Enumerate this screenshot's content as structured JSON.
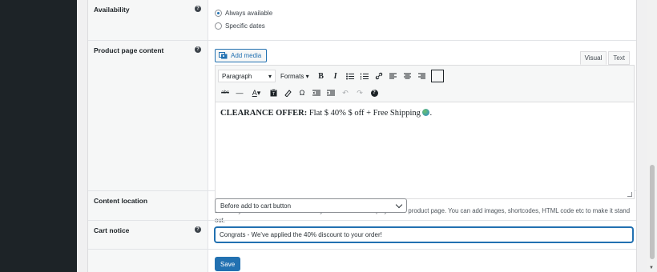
{
  "rows": {
    "availability": {
      "label": "Availability",
      "options": [
        "Always available",
        "Specific dates"
      ]
    },
    "product_content": {
      "label": "Product page content",
      "add_media": "Add media",
      "tabs": [
        "Visual",
        "Text"
      ],
      "toolbar": {
        "paragraph": "Paragraph",
        "formats": "Formats"
      },
      "content_bold": "CLEARANCE OFFER:",
      "content_rest": " Flat  $ 40% $  off + Free Shipping ",
      "content_end": ".",
      "description": "Enter any text about the discount that you would like to display on the product page. You can add images, shortcodes, HTML code etc to make it stand out."
    },
    "content_location": {
      "label": "Content location",
      "selected": "Before add to cart button"
    },
    "cart_notice": {
      "label": "Cart notice",
      "value": "Congrats - We've applied the 40% discount to your order!"
    }
  },
  "save_label": "Save",
  "colors": {
    "accent": "#2271b1",
    "sidebar": "#1d2327"
  }
}
